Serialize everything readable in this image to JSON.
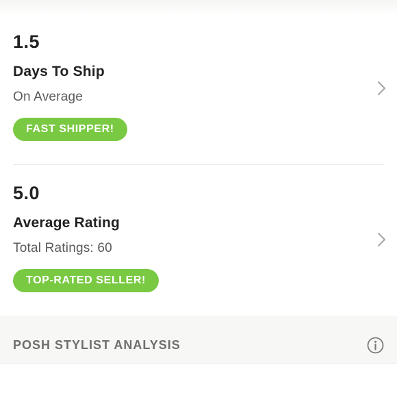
{
  "shipping_stat": {
    "value": "1.5",
    "title": "Days To Ship",
    "subtitle": "On Average",
    "badge": "FAST SHIPPER!"
  },
  "rating_stat": {
    "value": "5.0",
    "title": "Average Rating",
    "subtitle": "Total Ratings: 60",
    "badge": "TOP-RATED SELLER!"
  },
  "stylist_section": {
    "title": "POSH STYLIST ANALYSIS",
    "icon": "info-icon"
  },
  "colors": {
    "badge_green": "#7ac943",
    "text_dark": "#222222",
    "text_muted": "#5a5a5a",
    "section_bg": "#f7f7f5"
  },
  "icons": {
    "row_arrow": "chevron-right-icon"
  }
}
